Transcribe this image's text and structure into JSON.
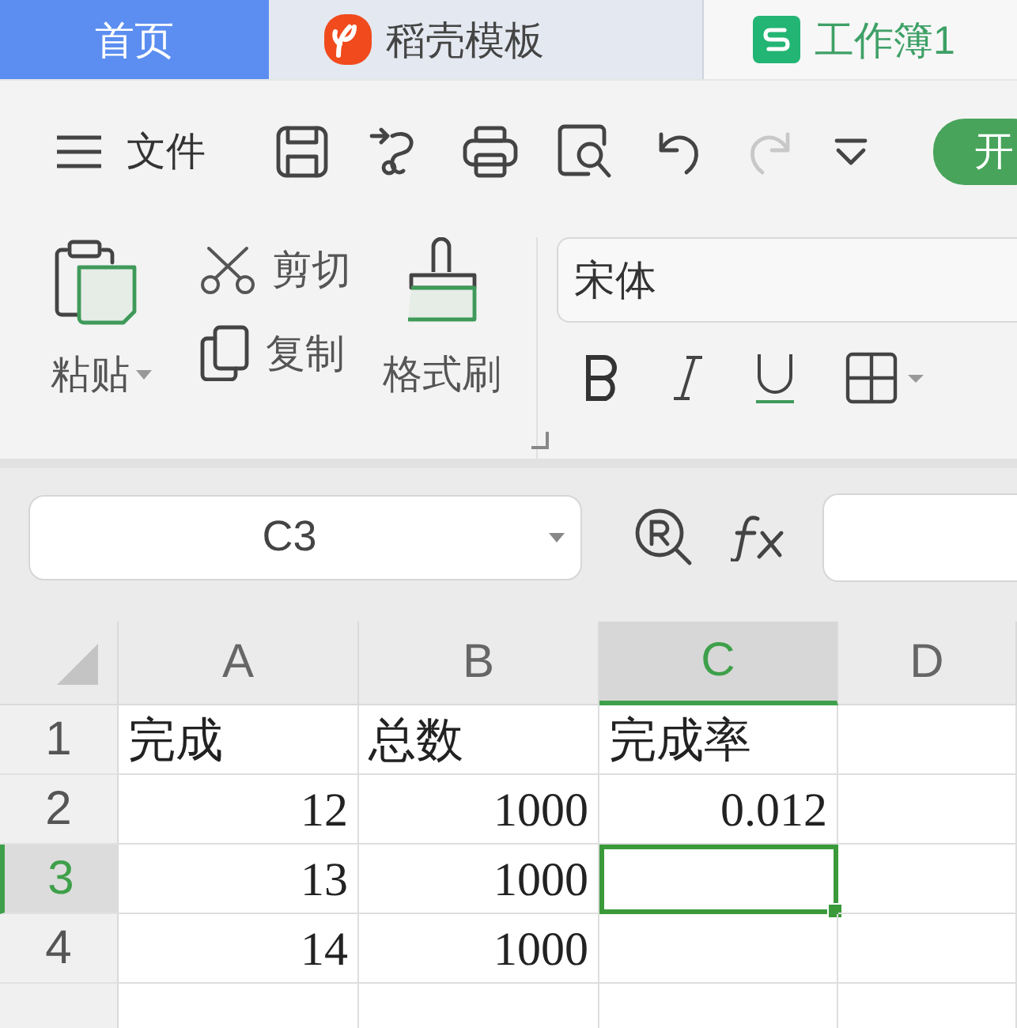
{
  "tabs": [
    {
      "label": "首页",
      "kind": "home",
      "selected": false
    },
    {
      "label": "稻壳模板",
      "kind": "docer",
      "selected": false
    },
    {
      "label": "工作簿1",
      "kind": "sheet",
      "selected": true
    }
  ],
  "toolbar": {
    "menu_label": "文件",
    "start_button": "开"
  },
  "ribbon": {
    "paste": "粘贴",
    "cut": "剪切",
    "copy": "复制",
    "format_painter": "格式刷",
    "font": "宋体"
  },
  "formula_bar": {
    "name_box": "C3"
  },
  "sheet": {
    "columns": [
      {
        "label": "A",
        "selected": false
      },
      {
        "label": "B",
        "selected": false
      },
      {
        "label": "C",
        "selected": true
      },
      {
        "label": "D",
        "selected": false
      }
    ],
    "rows": [
      {
        "label": "1",
        "selected": false,
        "cells": [
          {
            "text": "完成",
            "kind": "text"
          },
          {
            "text": "总数",
            "kind": "text"
          },
          {
            "text": "完成率",
            "kind": "text"
          }
        ]
      },
      {
        "label": "2",
        "selected": false,
        "cells": [
          {
            "text": "12",
            "kind": "number"
          },
          {
            "text": "1000",
            "kind": "number"
          },
          {
            "text": "0.012",
            "kind": "number"
          }
        ]
      },
      {
        "label": "3",
        "selected": true,
        "cells": [
          {
            "text": "13",
            "kind": "number"
          },
          {
            "text": "1000",
            "kind": "number"
          }
        ]
      },
      {
        "label": "4",
        "selected": false,
        "cells": [
          {
            "text": "14",
            "kind": "number"
          },
          {
            "text": "1000",
            "kind": "number"
          }
        ]
      }
    ]
  }
}
